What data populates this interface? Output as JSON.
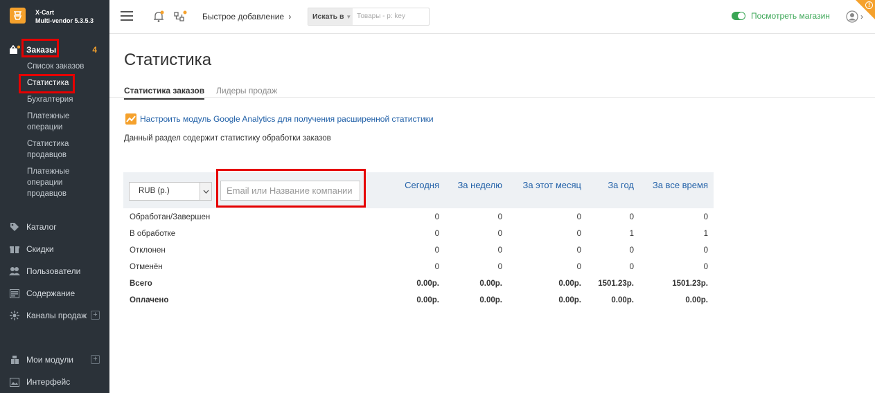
{
  "brand": {
    "line1": "X-Cart",
    "line2": "Multi-vendor 5.3.5.3"
  },
  "sidebar": {
    "orders": {
      "label": "Заказы",
      "count": "4",
      "subs": [
        "Список заказов",
        "Статистика",
        "Бухгалтерия",
        "Платежные операции",
        "Статистика продавцов",
        "Платежные операции продавцов"
      ]
    },
    "items": [
      {
        "label": "Каталог"
      },
      {
        "label": "Скидки"
      },
      {
        "label": "Пользователи"
      },
      {
        "label": "Содержание"
      },
      {
        "label": "Каналы продаж"
      },
      {
        "label": "Мои модули"
      },
      {
        "label": "Интерфейс"
      }
    ]
  },
  "header": {
    "quick_add": "Быстрое добавление",
    "search_scope": "Искать в",
    "search_placeholder": "Товары - р: key",
    "store_link": "Посмотреть магазин"
  },
  "page": {
    "title": "Статистика",
    "tabs": [
      "Статистика заказов",
      "Лидеры продаж"
    ],
    "ga_link": "Настроить модуль Google Analytics для получения расширенной статистики",
    "description": "Данный раздел содержит статистику обработки заказов"
  },
  "stats": {
    "currency": "RUB (р.)",
    "company_placeholder": "Email или Название компании",
    "columns": [
      "Сегодня",
      "За неделю",
      "За этот месяц",
      "За год",
      "За все время"
    ],
    "rows": [
      {
        "name": "Обработан/Завершен",
        "values": [
          "0",
          "0",
          "0",
          "0",
          "0"
        ]
      },
      {
        "name": "В обработке",
        "values": [
          "0",
          "0",
          "0",
          "1",
          "1"
        ]
      },
      {
        "name": "Отклонен",
        "values": [
          "0",
          "0",
          "0",
          "0",
          "0"
        ]
      },
      {
        "name": "Отменён",
        "values": [
          "0",
          "0",
          "0",
          "0",
          "0"
        ]
      },
      {
        "name": "Всего",
        "values": [
          "0.00р.",
          "0.00р.",
          "0.00р.",
          "1501.23р.",
          "1501.23р."
        ]
      },
      {
        "name": "Оплачено",
        "values": [
          "0.00р.",
          "0.00р.",
          "0.00р.",
          "0.00р.",
          "0.00р."
        ]
      }
    ]
  },
  "colors": {
    "sidebar_bg": "#2b3239",
    "accent": "#f5a12c",
    "link": "#2261a8",
    "green": "#3aa655",
    "highlight": "#e60000"
  }
}
